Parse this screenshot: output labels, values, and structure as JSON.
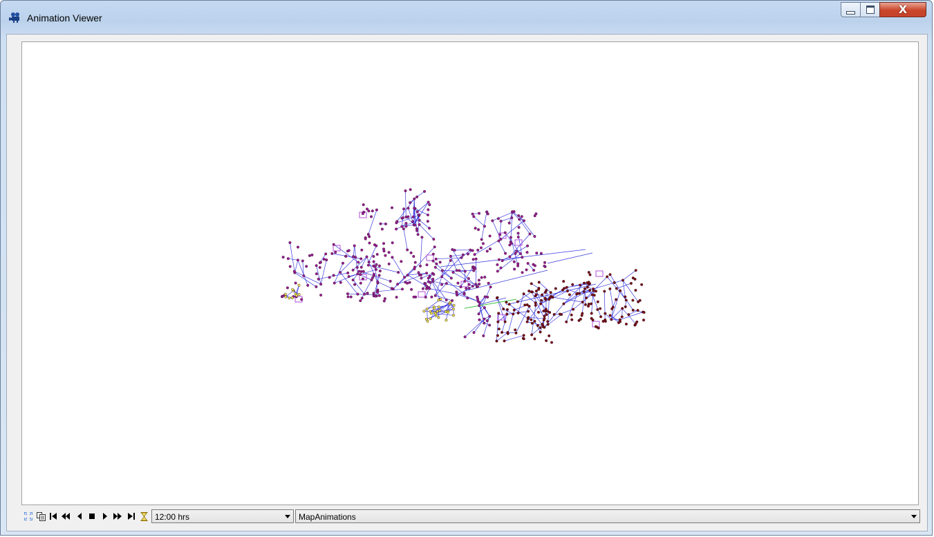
{
  "window": {
    "title": "Animation Viewer",
    "close_label": "X"
  },
  "toolbar": {
    "time_value": "12:00 hrs",
    "animation_value": "MapAnimations"
  },
  "colors": {
    "node_purple": "#9b1c8e",
    "node_maroon": "#7a0f0f",
    "node_yellow": "#e8e04a",
    "pipe_blue": "#3a3ae0",
    "pipe_green": "#3cc43c",
    "tank_outline": "#b04cd8"
  },
  "icons": {
    "title": "camera-icon",
    "fit": "zoom-extents-icon",
    "copy": "copy-icon",
    "first": "first-frame-icon",
    "rewind": "rewind-icon",
    "back": "step-back-icon",
    "stop": "stop-icon",
    "play": "play-icon",
    "forward": "fast-forward-icon",
    "last": "last-frame-icon",
    "time": "hourglass-icon"
  }
}
